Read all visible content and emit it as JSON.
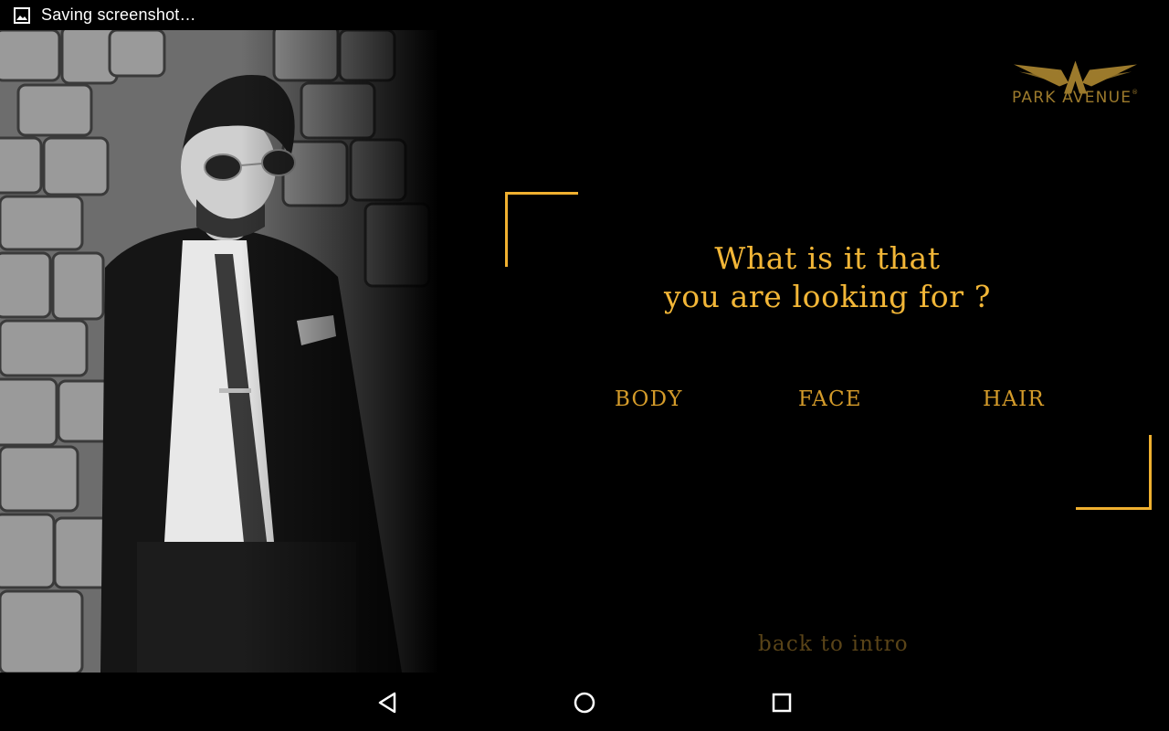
{
  "status_bar": {
    "notification_icon": "image-icon",
    "text": "Saving screenshot…"
  },
  "brand": {
    "logo_icon": "winged-emblem-icon",
    "name": "PARK AVENUE"
  },
  "main": {
    "question_line1": "What is it that",
    "question_line2": "you are looking for ?",
    "options": [
      {
        "label": "BODY"
      },
      {
        "label": "FACE"
      },
      {
        "label": "HAIR"
      }
    ],
    "back_link": "back to intro"
  },
  "colors": {
    "accent": "#f0b030",
    "background": "#000000",
    "logo_gold": "#9c7a2c",
    "muted_link": "#5a4418"
  },
  "nav_bar": {
    "back_icon": "triangle-back-icon",
    "home_icon": "circle-home-icon",
    "recent_icon": "square-recents-icon"
  }
}
